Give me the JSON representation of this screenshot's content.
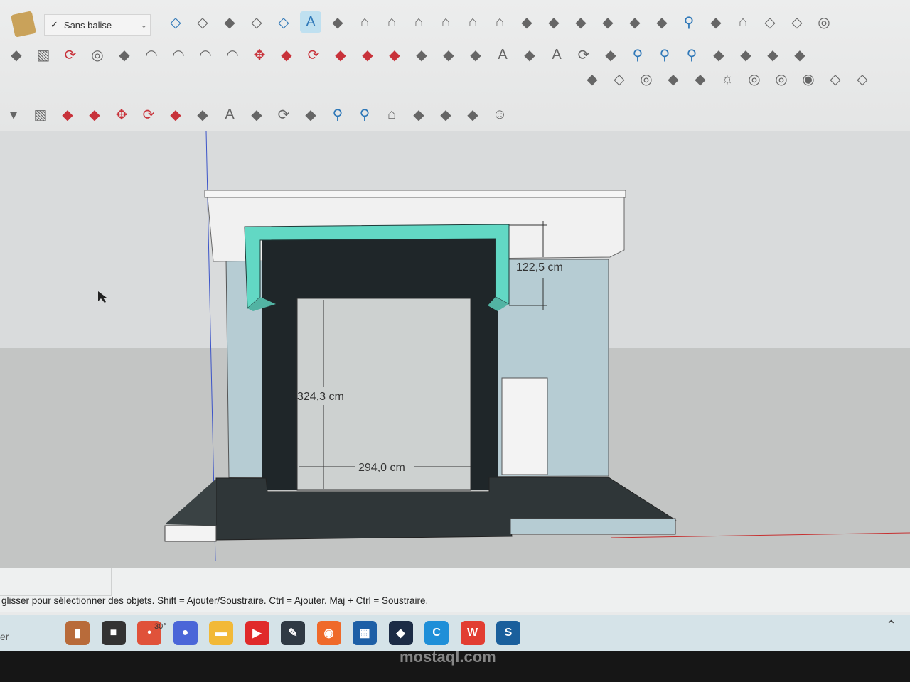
{
  "toolbar": {
    "tag_select": {
      "value": "Sans balise",
      "check": "✓"
    },
    "row1": [
      "xray-box-icon",
      "wireframe-box-icon",
      "hidden-line-icon",
      "hidden-box-icon",
      "shaded-box-icon",
      "shaded-texture-icon",
      "monochrome-icon",
      "house-iso-icon",
      "house-top-icon",
      "house-front-icon",
      "house-right-icon",
      "house-back-icon",
      "house-left-icon",
      "group-icon",
      "component-icon",
      "solid-union-icon",
      "solid-subtract-icon",
      "solid-trim-icon",
      "solid-split-icon",
      "search-icon",
      "grid-icon",
      "warehouse-icon",
      "cube-outline-icon",
      "cube-grid-icon",
      "sphere-grid-icon"
    ],
    "row2": [
      "freehand-icon",
      "rectangle-icon",
      "rotated-rectangle-icon",
      "circle-icon",
      "polygon-icon",
      "arc-icon",
      "pie-icon",
      "three-point-arc-icon",
      "two-point-arc-icon",
      "move-icon",
      "push-pull-icon",
      "rotate-icon",
      "follow-me-icon",
      "scale-icon",
      "offset-icon",
      "tape-measure-icon",
      "dimension-icon",
      "protractor-icon",
      "text-icon",
      "axes-icon",
      "3d-text-icon",
      "orbit-icon",
      "pan-icon",
      "zoom-icon",
      "zoom-window-icon",
      "zoom-extents-icon",
      "walk-icon",
      "look-around-icon",
      "footprints-icon",
      "position-camera-icon"
    ],
    "row3": [
      "camera-icon",
      "sandbox-icon",
      "target-icon",
      "section-icon",
      "stool-icon",
      "sun-icon",
      "dome-icon",
      "sphere-icon",
      "eye-icon",
      "box-3d-icon",
      "box-settings-icon"
    ],
    "row4": [
      "select-dropdown-icon",
      "rectangle-icon",
      "push-pull-icon",
      "follow-me-icon",
      "move-icon",
      "rotate-icon",
      "scale-icon",
      "tape-measure-icon",
      "text-icon",
      "paint-bucket-icon",
      "orbit-icon",
      "pan-icon",
      "zoom-icon",
      "zoom-extents-icon",
      "warehouse-icon",
      "extension-icon",
      "layers-icon",
      "settings-icon",
      "user-icon"
    ]
  },
  "model": {
    "dimensions": {
      "height_right": "122,5 cm",
      "height_opening": "324,3 cm",
      "width_opening": "294,0 cm"
    }
  },
  "status": {
    "text": "glisser pour sélectionner des objets. Shift = Ajouter/Soustraire. Ctrl = Ajouter. Maj + Ctrl = Soustraire."
  },
  "taskbar": {
    "search_stub": "er",
    "weather": "30°",
    "apps": [
      {
        "name": "library",
        "color": "#b86b3a",
        "glyph": "▮"
      },
      {
        "name": "desktop",
        "color": "#333333",
        "glyph": "■"
      },
      {
        "name": "weather",
        "color": "#e0523a",
        "glyph": "•"
      },
      {
        "name": "meet",
        "color": "#4a66d8",
        "glyph": "●"
      },
      {
        "name": "file-explorer",
        "color": "#f2b937",
        "glyph": "▬"
      },
      {
        "name": "youtube",
        "color": "#e02a2a",
        "glyph": "▶"
      },
      {
        "name": "notes",
        "color": "#2f3a44",
        "glyph": "✎"
      },
      {
        "name": "firefox",
        "color": "#ef6a2a",
        "glyph": "◉"
      },
      {
        "name": "store",
        "color": "#1d5fa6",
        "glyph": "▦"
      },
      {
        "name": "vpn",
        "color": "#1c2c46",
        "glyph": "◆"
      },
      {
        "name": "edge",
        "color": "#1f8fd8",
        "glyph": "C"
      },
      {
        "name": "wps",
        "color": "#e23d32",
        "glyph": "W"
      },
      {
        "name": "sketchup",
        "color": "#1a5f9c",
        "glyph": "S"
      }
    ]
  },
  "watermark": "mostaql.com",
  "colors": {
    "trim": "#62d8c4",
    "frame": "#1f2629",
    "wall": "#b6ccd3",
    "mantel": "#f2f2f2"
  }
}
